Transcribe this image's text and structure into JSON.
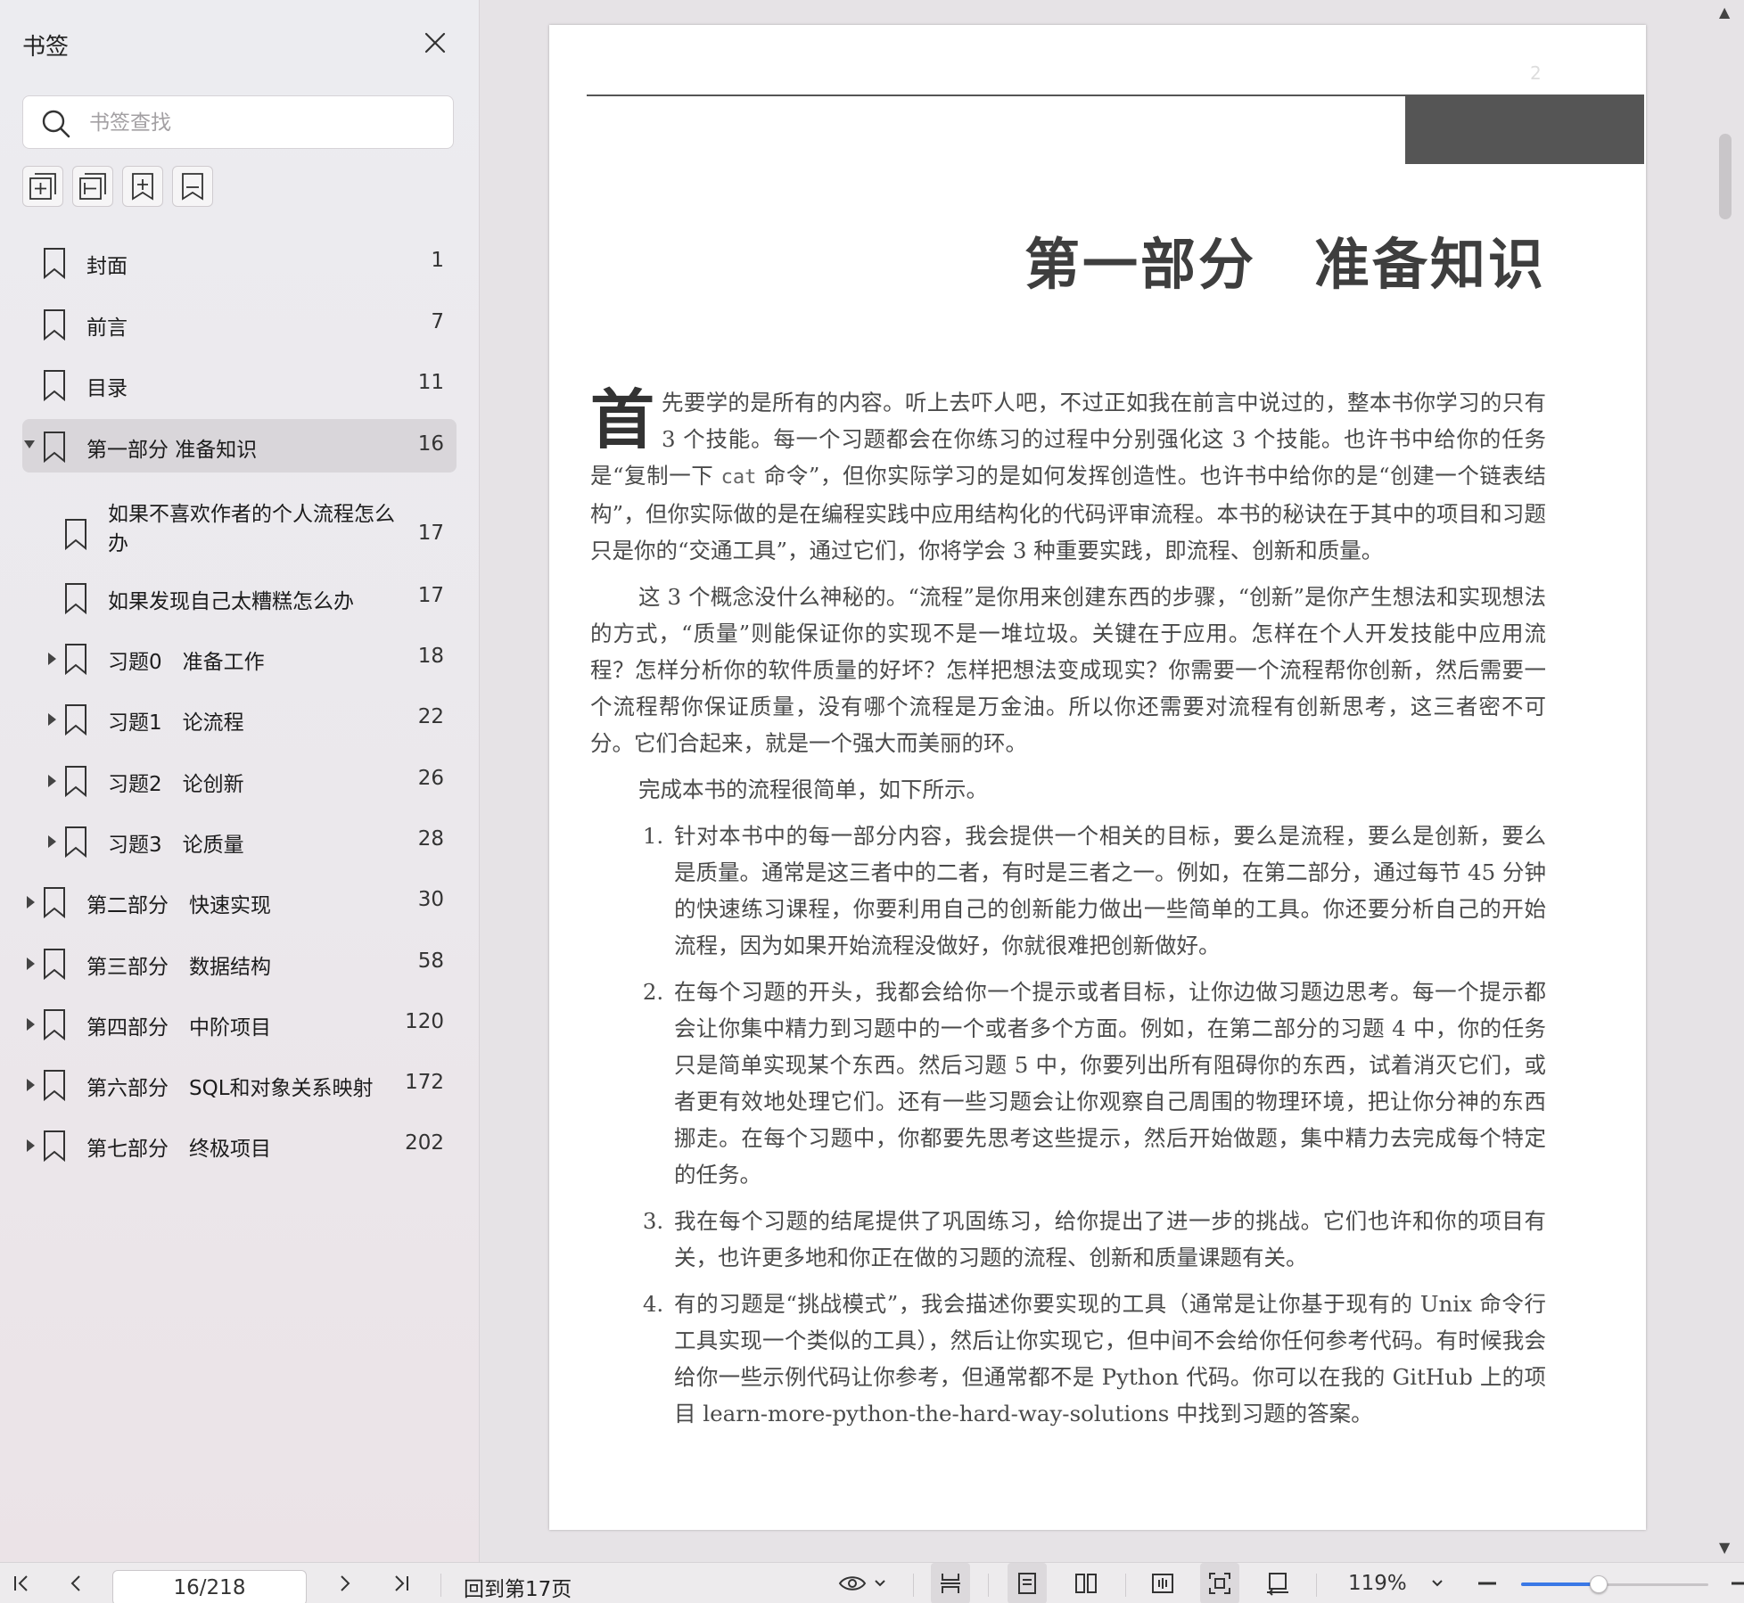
{
  "sidebar": {
    "title": "书签",
    "search_placeholder": "书签查找",
    "toolbar_icons": [
      "expand-all-icon",
      "collapse-all-icon",
      "add-bookmark-icon",
      "bookmark-icon"
    ],
    "items": [
      {
        "label": "封面",
        "page": "1",
        "level": 0,
        "toggle": "none",
        "selected": false
      },
      {
        "label": "前言",
        "page": "7",
        "level": 0,
        "toggle": "none",
        "selected": false
      },
      {
        "label": "目录",
        "page": "11",
        "level": 0,
        "toggle": "none",
        "selected": false
      },
      {
        "label": "第一部分 准备知识",
        "page": "16",
        "level": 0,
        "toggle": "expanded",
        "selected": true
      },
      {
        "label": "如果不喜欢作者的个人流程怎么办",
        "page": "17",
        "level": 1,
        "toggle": "none",
        "selected": false,
        "wrap": true
      },
      {
        "label": "如果发现自己太糟糕怎么办",
        "page": "17",
        "level": 1,
        "toggle": "none",
        "selected": false
      },
      {
        "label": "习题0　准备工作",
        "page": "18",
        "level": 1,
        "toggle": "collapsed",
        "selected": false
      },
      {
        "label": "习题1　论流程",
        "page": "22",
        "level": 1,
        "toggle": "collapsed",
        "selected": false
      },
      {
        "label": "习题2　论创新",
        "page": "26",
        "level": 1,
        "toggle": "collapsed",
        "selected": false
      },
      {
        "label": "习题3　论质量",
        "page": "28",
        "level": 1,
        "toggle": "collapsed",
        "selected": false
      },
      {
        "label": "第二部分　快速实现",
        "page": "30",
        "level": 0,
        "toggle": "collapsed",
        "selected": false
      },
      {
        "label": "第三部分　数据结构",
        "page": "58",
        "level": 0,
        "toggle": "collapsed",
        "selected": false
      },
      {
        "label": "第四部分　中阶项目",
        "page": "120",
        "level": 0,
        "toggle": "collapsed",
        "selected": false
      },
      {
        "label": "第六部分　SQL和对象关系映射",
        "page": "172",
        "level": 0,
        "toggle": "collapsed",
        "selected": false
      },
      {
        "label": "第七部分　终极项目",
        "page": "202",
        "level": 0,
        "toggle": "collapsed",
        "selected": false
      }
    ]
  },
  "document": {
    "header_number": "2",
    "part_title": "第一部分　准备知识",
    "dropcap": "首",
    "para1": "先要学的是所有的内容。听上去吓人吧，不过正如我在前言中说过的，整本书你学习的只有 3 个技能。每一个习题都会在你练习的过程中分别强化这 3 个技能。也许书中给你的任务是“复制一下 ",
    "para1_code": "cat",
    "para1_rest": " 命令”，但你实际学习的是如何发挥创造性。也许书中给你的是“创建一个链表结构”，但你实际做的是在编程实践中应用结构化的代码评审流程。本书的秘诀在于其中的项目和习题只是你的“交通工具”，通过它们，你将学会 3 种重要实践，即流程、创新和质量。",
    "para2": "这 3 个概念没什么神秘的。“流程”是你用来创建东西的步骤，“创新”是你产生想法和实现想法的方式，“质量”则能保证你的实现不是一堆垃圾。关键在于应用。怎样在个人开发技能中应用流程？怎样分析你的软件质量的好坏？怎样把想法变成现实？你需要一个流程帮你创新，然后需要一个流程帮你保证质量，没有哪个流程是万金油。所以你还需要对流程有创新思考，这三者密不可分。它们合起来，就是一个强大而美丽的环。",
    "para3": "完成本书的流程很简单，如下所示。",
    "list": [
      "针对本书中的每一部分内容，我会提供一个相关的目标，要么是流程，要么是创新，要么是质量。通常是这三者中的二者，有时是三者之一。例如，在第二部分，通过每节 45 分钟的快速练习课程，你要利用自己的创新能力做出一些简单的工具。你还要分析自己的开始流程，因为如果开始流程没做好，你就很难把创新做好。",
      "在每个习题的开头，我都会给你一个提示或者目标，让你边做习题边思考。每一个提示都会让你集中精力到习题中的一个或者多个方面。例如，在第二部分的习题 4 中，你的任务只是简单实现某个东西。然后习题 5 中，你要列出所有阻碍你的东西，试着消灭它们，或者更有效地处理它们。还有一些习题会让你观察自己周围的物理环境，把让你分神的东西挪走。在每个习题中，你都要先思考这些提示，然后开始做题，集中精力去完成每个特定的任务。",
      "我在每个习题的结尾提供了巩固练习，给你提出了进一步的挑战。它们也许和你的项目有关，也许更多地和你正在做的习题的流程、创新和质量课题有关。",
      "有的习题是“挑战模式”，我会描述你要实现的工具（通常是让你基于现有的 Unix 命令行工具实现一个类似的工具），然后让你实现它，但中间不会给你任何参考代码。有时候我会给你一些示例代码让你参考，但通常都不是 Python 代码。你可以在我的 GitHub 上的项目 learn-more-python-the-hard-way-solutions 中找到习题的答案。"
    ]
  },
  "bottombar": {
    "page_input": "16/218",
    "back_to_page": "回到第17页",
    "zoom": "119%",
    "zoom_slider_fraction": 0.41,
    "accent_color": "#3a78e6"
  }
}
